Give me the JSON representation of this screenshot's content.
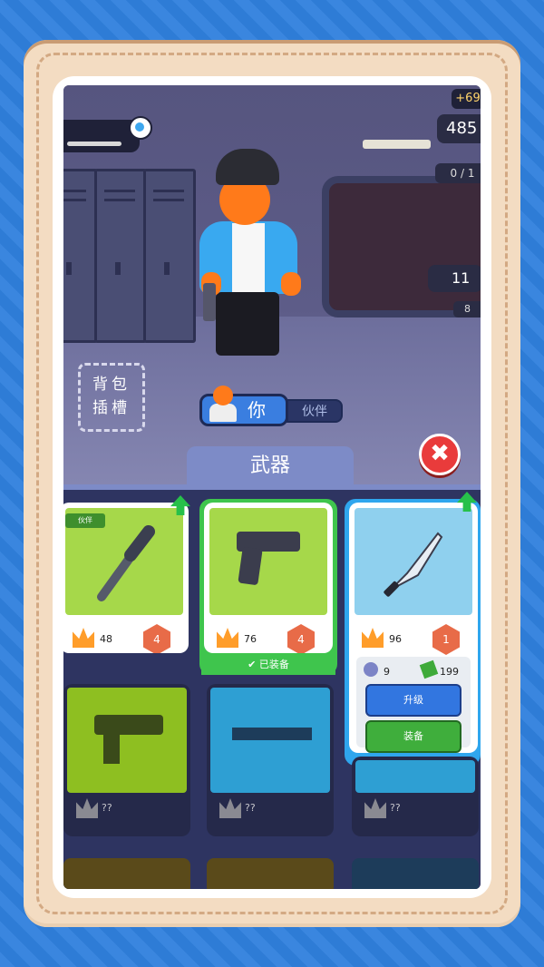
{
  "hud": {
    "coin_gain": "+69",
    "coins": "485",
    "progress_fraction": "0 / 1",
    "gear_count": "11",
    "gear_sub": "8"
  },
  "scene": {
    "backpack_slot_label": "背包\n插槽"
  },
  "toggle": {
    "you_label": "你",
    "partner_label": "伙伴"
  },
  "tab_label": "武器",
  "cards": [
    {
      "name": "spiked-bat",
      "power": "48",
      "level": "4",
      "tag": "伙伴",
      "upgradable": true,
      "color": "#a6d84a"
    },
    {
      "name": "pistol",
      "power": "76",
      "level": "4",
      "status": "已装备",
      "color": "#a6d84a"
    },
    {
      "name": "knife",
      "power": "96",
      "level": "1",
      "upgradable": true,
      "color": "#8fd0ee",
      "upgrade_gear_cost": "9",
      "upgrade_cash_cost": "199",
      "upgrade_button": "升级",
      "equip_button": "装备"
    }
  ],
  "locked": [
    {
      "name": "smg",
      "label": "??",
      "color": "#8ebf21"
    },
    {
      "name": "rifle",
      "label": "??",
      "color": "#2e9fd3"
    },
    {
      "name": "unknown",
      "label": "??",
      "color": "#2e9fd3"
    }
  ],
  "colors": {
    "accent": "#3fc54d",
    "background": "#2f80dd",
    "frame": "#f3dcc2"
  }
}
